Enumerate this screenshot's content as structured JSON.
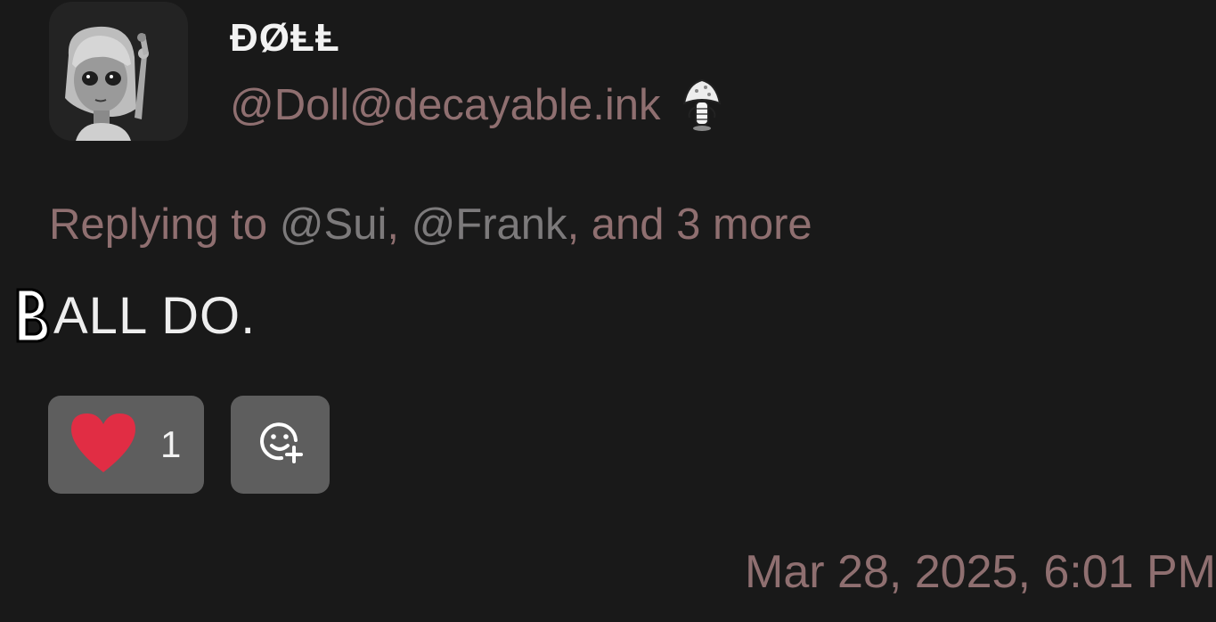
{
  "author": {
    "display_name": "ĐØⱠⱠ",
    "handle": "@Doll@decayable.ink",
    "avatar_icon": "doll-avatar",
    "badge_icon": "mushroom-icon"
  },
  "reply": {
    "prefix": "Replying to ",
    "mention_1": "@Sui",
    "sep_1": ", ",
    "mention_2": "@Frank",
    "suffix": ", and 3 more"
  },
  "content": {
    "emoji_icon": "letter-b-emoji-icon",
    "text": "ALL DO."
  },
  "reactions": {
    "like": {
      "icon": "heart-icon",
      "count": "1"
    },
    "add": {
      "icon": "add-reaction-icon"
    }
  },
  "timestamp": "Mar 28, 2025, 6:01 PM",
  "colors": {
    "background": "#191919",
    "muted": "#8f6f70",
    "mention": "#7c7a7b",
    "reaction_bg": "#5e5e5e",
    "heart": "#e12d44"
  }
}
